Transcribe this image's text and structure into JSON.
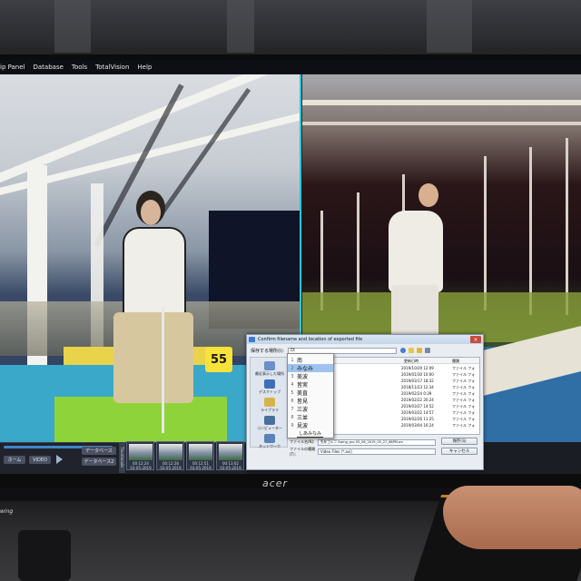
{
  "menu": [
    "ip Panel",
    "Database",
    "Tools",
    "TotalVision",
    "Help"
  ],
  "monitor_brand": "acer",
  "left_video": {
    "bay_number": "55"
  },
  "toolbar": {
    "buttons": [
      "データベース",
      "ホーム",
      "VIDEO",
      "データベース2"
    ],
    "vertical_tab": "Thumbnails",
    "thumbnails": [
      {
        "time": "00:12:24",
        "date": "03-05-2019"
      },
      {
        "time": "00:12:28",
        "date": "03-05-2019"
      },
      {
        "time": "00:12:51",
        "date": "03-05-2019"
      },
      {
        "time": "00:13:02",
        "date": "03-05-2019"
      },
      {
        "time": "",
        "date": ""
      }
    ]
  },
  "dialog": {
    "title": "Confirm filename and location of exported file",
    "save_in_label": "保存する場所(I):",
    "save_in_value": "D:",
    "places": [
      "最近表示した場所",
      "デスクトップ",
      "ライブラリ",
      "コンピューター",
      "ネットワーク"
    ],
    "columns": {
      "name": "名前",
      "date": "更新日時",
      "type": "種類"
    },
    "files": [
      {
        "date": "2019/10/29 12:09",
        "type": "ファイル フォ"
      },
      {
        "date": "2019/01/30 10:00",
        "type": "ファイル フォ"
      },
      {
        "date": "2019/03/17 18:32",
        "type": "ファイル フォ"
      },
      {
        "date": "2018/11/23 12:34",
        "type": "ファイル フォ"
      },
      {
        "date": "2019/02/24 0:39",
        "type": "ファイル フォ"
      },
      {
        "date": "2019/02/22 20:24",
        "type": "ファイル フォ"
      },
      {
        "date": "2019/03/27 14:52",
        "type": "ファイル フォ"
      },
      {
        "date": "2019/03/22 14:57",
        "type": "ファイル フォ"
      },
      {
        "date": "2019/02/26 11:25",
        "type": "ファイル フォ"
      },
      {
        "date": "2019/03/04 16:24",
        "type": "ファイル フォ"
      }
    ],
    "filename_label": "ファイル名(N):",
    "filename_value": "先年ゴルフ Swing_pro 05_06_2019_05_27_68PM.avi",
    "filetype_label": "ファイルの種類(T):",
    "filetype_value": "Video Files (*.avi)",
    "save_button": "保存(S)",
    "cancel_button": "キャンセル"
  },
  "ime": {
    "input": "しあみなみ",
    "candidates": [
      "南",
      "みなみ",
      "美波",
      "皆実",
      "美直",
      "皆見",
      "三波",
      "三並",
      "見波"
    ]
  },
  "sticker_text": "wing"
}
